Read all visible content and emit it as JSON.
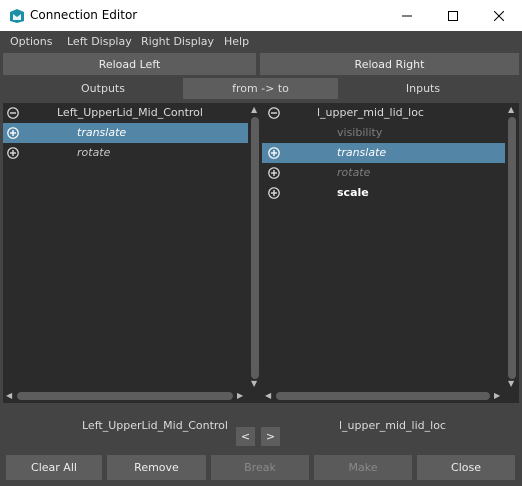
{
  "window": {
    "title": "Connection Editor",
    "controls": {
      "minimize_icon": "minimize-icon",
      "maximize_icon": "maximize-icon",
      "close_icon": "close-icon"
    }
  },
  "menubar": [
    "Options",
    "Left Display",
    "Right Display",
    "Help"
  ],
  "reload": {
    "left": "Reload Left",
    "right": "Reload Right"
  },
  "tabs": {
    "outputs": "Outputs",
    "direction": "from -> to",
    "inputs": "Inputs"
  },
  "left_panel": {
    "node": "Left_UpperLid_Mid_Control",
    "attrs": [
      {
        "label": "translate",
        "selected": true,
        "italic": true
      },
      {
        "label": "rotate",
        "selected": false,
        "italic": true
      }
    ]
  },
  "right_panel": {
    "node": "l_upper_mid_lid_loc",
    "attrs": [
      {
        "label": "visibility",
        "selected": false,
        "dim": true
      },
      {
        "label": "translate",
        "selected": true,
        "italic": true
      },
      {
        "label": "rotate",
        "selected": false,
        "italic": true,
        "dim": true
      },
      {
        "label": "scale",
        "selected": false,
        "bold": true
      }
    ]
  },
  "bottom": {
    "left_node": "Left_UpperLid_Mid_Control",
    "right_node": "l_upper_mid_lid_loc",
    "prev": "<",
    "next": ">"
  },
  "actions": {
    "clear_all": "Clear All",
    "remove": "Remove",
    "break": "Break",
    "make": "Make",
    "close": "Close"
  },
  "colors": {
    "background": "#444444",
    "panel": "#2b2b2b",
    "selection": "#5285a6",
    "button": "#5d5d5d",
    "direction_tab": "#5d5d5d"
  }
}
